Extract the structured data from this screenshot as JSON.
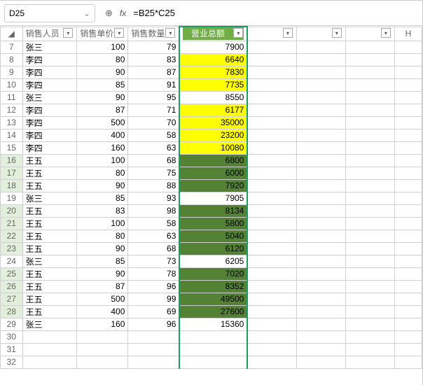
{
  "nameBox": "D25",
  "formula": "=B25*C25",
  "icons": {
    "zoom": "⊕",
    "fx": "fx",
    "chev": "⌄"
  },
  "colHeaders": [
    "H"
  ],
  "dataHeaders": {
    "a": "销售人员",
    "b": "销售单价",
    "c": "销售数量",
    "d": "营业总额"
  },
  "rows": [
    {
      "r": 7,
      "a": "张三",
      "b": 100,
      "c": 79,
      "d": 7900,
      "ybg": false,
      "gRow": false,
      "gCell": false
    },
    {
      "r": 8,
      "a": "李四",
      "b": 80,
      "c": 83,
      "d": 6640,
      "ybg": true,
      "gRow": false,
      "gCell": false
    },
    {
      "r": 9,
      "a": "李四",
      "b": 90,
      "c": 87,
      "d": 7830,
      "ybg": true,
      "gRow": false,
      "gCell": false
    },
    {
      "r": 10,
      "a": "李四",
      "b": 85,
      "c": 91,
      "d": 7735,
      "ybg": true,
      "gRow": false,
      "gCell": false
    },
    {
      "r": 11,
      "a": "张三",
      "b": 90,
      "c": 95,
      "d": 8550,
      "ybg": false,
      "gRow": false,
      "gCell": false
    },
    {
      "r": 12,
      "a": "李四",
      "b": 87,
      "c": 71,
      "d": 6177,
      "ybg": true,
      "gRow": false,
      "gCell": false
    },
    {
      "r": 13,
      "a": "李四",
      "b": 500,
      "c": 70,
      "d": 35000,
      "ybg": true,
      "gRow": false,
      "gCell": false
    },
    {
      "r": 14,
      "a": "李四",
      "b": 400,
      "c": 58,
      "d": 23200,
      "ybg": true,
      "gRow": false,
      "gCell": false
    },
    {
      "r": 15,
      "a": "李四",
      "b": 160,
      "c": 63,
      "d": 10080,
      "ybg": true,
      "gRow": false,
      "gCell": false
    },
    {
      "r": 16,
      "a": "王五",
      "b": 100,
      "c": 68,
      "d": 6800,
      "ybg": false,
      "gRow": true,
      "gCell": true
    },
    {
      "r": 17,
      "a": "王五",
      "b": 80,
      "c": 75,
      "d": 6000,
      "ybg": false,
      "gRow": true,
      "gCell": true
    },
    {
      "r": 18,
      "a": "王五",
      "b": 90,
      "c": 88,
      "d": 7920,
      "ybg": false,
      "gRow": true,
      "gCell": true
    },
    {
      "r": 19,
      "a": "张三",
      "b": 85,
      "c": 93,
      "d": 7905,
      "ybg": false,
      "gRow": false,
      "gCell": false
    },
    {
      "r": 20,
      "a": "王五",
      "b": 83,
      "c": 98,
      "d": 8134,
      "ybg": false,
      "gRow": true,
      "gCell": true
    },
    {
      "r": 21,
      "a": "王五",
      "b": 100,
      "c": 58,
      "d": 5800,
      "ybg": false,
      "gRow": true,
      "gCell": true
    },
    {
      "r": 22,
      "a": "王五",
      "b": 80,
      "c": 63,
      "d": 5040,
      "ybg": false,
      "gRow": true,
      "gCell": true
    },
    {
      "r": 23,
      "a": "王五",
      "b": 90,
      "c": 68,
      "d": 6120,
      "ybg": false,
      "gRow": true,
      "gCell": true
    },
    {
      "r": 24,
      "a": "张三",
      "b": 85,
      "c": 73,
      "d": 6205,
      "ybg": false,
      "gRow": false,
      "gCell": false
    },
    {
      "r": 25,
      "a": "王五",
      "b": 90,
      "c": 78,
      "d": 7020,
      "ybg": false,
      "gRow": true,
      "gCell": true
    },
    {
      "r": 26,
      "a": "王五",
      "b": 87,
      "c": 96,
      "d": 8352,
      "ybg": false,
      "gRow": true,
      "gCell": true
    },
    {
      "r": 27,
      "a": "王五",
      "b": 500,
      "c": 99,
      "d": 49500,
      "ybg": false,
      "gRow": true,
      "gCell": true
    },
    {
      "r": 28,
      "a": "王五",
      "b": 400,
      "c": 69,
      "d": 27600,
      "ybg": false,
      "gRow": true,
      "gCell": true
    },
    {
      "r": 29,
      "a": "张三",
      "b": 160,
      "c": 96,
      "d": 15360,
      "ybg": false,
      "gRow": false,
      "gCell": false
    }
  ],
  "emptyRows": [
    30,
    31,
    32
  ]
}
